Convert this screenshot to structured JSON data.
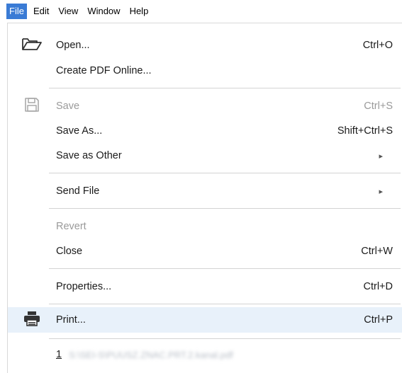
{
  "menubar": {
    "items": [
      {
        "label": "File",
        "active": true
      },
      {
        "label": "Edit",
        "active": false
      },
      {
        "label": "View",
        "active": false
      },
      {
        "label": "Window",
        "active": false
      },
      {
        "label": "Help",
        "active": false
      }
    ]
  },
  "file_menu": {
    "open": {
      "label": "Open...",
      "shortcut": "Ctrl+O",
      "icon": "folder-open-icon"
    },
    "create_pdf": {
      "label": "Create PDF Online..."
    },
    "save": {
      "label": "Save",
      "shortcut": "Ctrl+S",
      "icon": "floppy-disk-icon",
      "enabled": false
    },
    "save_as": {
      "label": "Save As...",
      "shortcut": "Shift+Ctrl+S"
    },
    "save_as_other": {
      "label": "Save as Other",
      "submenu_indicator": "▸"
    },
    "send_file": {
      "label": "Send File",
      "submenu_indicator": "▸"
    },
    "revert": {
      "label": "Revert",
      "enabled": false
    },
    "close": {
      "label": "Close",
      "shortcut": "Ctrl+W"
    },
    "properties": {
      "label": "Properties...",
      "shortcut": "Ctrl+D"
    },
    "print": {
      "label": "Print...",
      "shortcut": "Ctrl+P",
      "icon": "printer-icon"
    },
    "recent": {
      "number": "1",
      "file_name": "S:\\SEI-S\\PUUSZ.ZNAC.PRT.2.kanal.pdf"
    }
  },
  "colors": {
    "menubar_active_bg": "#3a7bd5",
    "highlight_row_bg": "#e8f1fa",
    "disabled_text": "#9a9a9a",
    "separator": "#d3d3d3"
  }
}
